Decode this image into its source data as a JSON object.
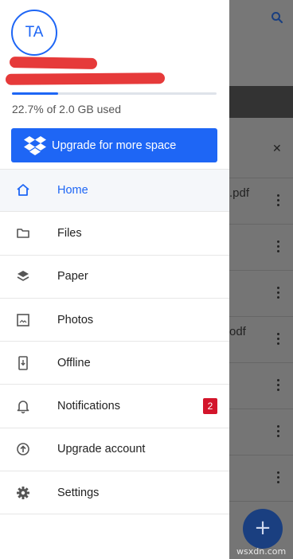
{
  "account": {
    "initials": "TA"
  },
  "storage": {
    "used_text": "22.7% of 2.0 GB used",
    "fraction_used": 0.227
  },
  "upgrade_button": {
    "label": "Upgrade for more space",
    "icon": "dropbox-logo-icon"
  },
  "menu": {
    "items": [
      {
        "label": "Home",
        "icon": "home-icon",
        "active": true
      },
      {
        "label": "Files",
        "icon": "folder-icon"
      },
      {
        "label": "Paper",
        "icon": "layers-icon"
      },
      {
        "label": "Photos",
        "icon": "photo-icon"
      },
      {
        "label": "Offline",
        "icon": "offline-device-icon"
      },
      {
        "label": "Notifications",
        "icon": "bell-icon",
        "badge": "2"
      },
      {
        "label": "Upgrade account",
        "icon": "upgrade-arrow-icon"
      },
      {
        "label": "Settings",
        "icon": "gear-icon"
      }
    ]
  },
  "background": {
    "file_fragments": [
      ".pdf",
      "odf"
    ],
    "watermark": "wsxdn.com"
  },
  "colors": {
    "accent": "#1e66f5",
    "badge": "#d3152b",
    "redaction": "#e63a3a",
    "scrim": "#757575"
  }
}
